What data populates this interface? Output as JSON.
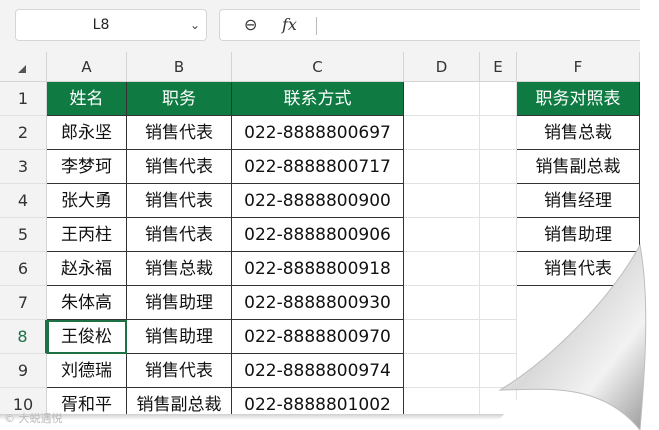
{
  "formula_bar": {
    "cell_ref": "L8",
    "caret": "⌄",
    "zoom_glyph": "⊖",
    "fx_label": "fx",
    "formula": ""
  },
  "columns": [
    "A",
    "B",
    "C",
    "D",
    "E",
    "F"
  ],
  "rows": [
    "1",
    "2",
    "3",
    "4",
    "5",
    "6",
    "7",
    "8",
    "9",
    "10"
  ],
  "active_row": "8",
  "table": {
    "headers": [
      "姓名",
      "职务",
      "联系方式"
    ],
    "rows": [
      [
        "郎永坚",
        "销售代表",
        "022-8888800697"
      ],
      [
        "李梦珂",
        "销售代表",
        "022-8888800717"
      ],
      [
        "张大勇",
        "销售代表",
        "022-8888800900"
      ],
      [
        "王丙柱",
        "销售代表",
        "022-8888800906"
      ],
      [
        "赵永福",
        "销售总裁",
        "022-8888800918"
      ],
      [
        "朱体高",
        "销售助理",
        "022-8888800930"
      ],
      [
        "王俊松",
        "销售助理",
        "022-8888800970"
      ],
      [
        "刘德瑞",
        "销售代表",
        "022-8888800974"
      ],
      [
        "胥和平",
        "销售副总裁",
        "022-8888801002"
      ]
    ]
  },
  "lookup": {
    "header": "职务对照表",
    "items": [
      "销售总裁",
      "销售副总裁",
      "销售经理",
      "销售助理",
      "销售代表"
    ]
  },
  "watermark": "© 大蜕遇悦",
  "colors": {
    "header_fill": "#0f7b43",
    "selection": "#1e7145"
  }
}
